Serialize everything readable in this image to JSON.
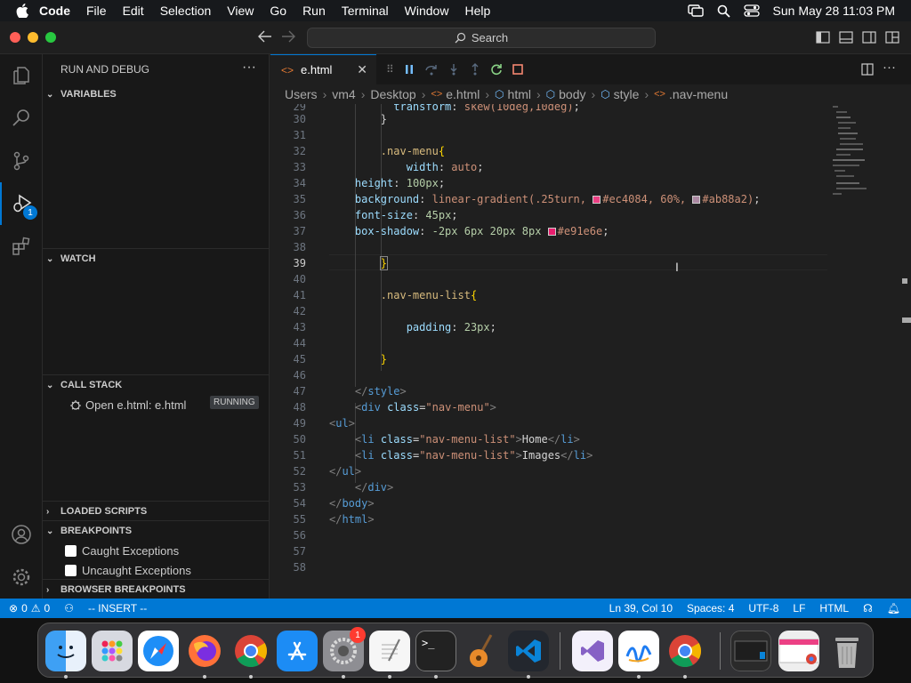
{
  "menubar": {
    "app": "Code",
    "items": [
      "File",
      "Edit",
      "Selection",
      "View",
      "Go",
      "Run",
      "Terminal",
      "Window",
      "Help"
    ],
    "clock": "Sun May 28  11:03 PM"
  },
  "titlebar": {
    "command_center": "Search"
  },
  "activity": {
    "debug_badge": "1"
  },
  "sidebar": {
    "title": "RUN AND DEBUG",
    "variables": "VARIABLES",
    "watch": "WATCH",
    "call_stack": "CALL STACK",
    "call_stack_item": "Open e.html: e.html",
    "call_stack_status": "RUNNING",
    "loaded_scripts": "LOADED SCRIPTS",
    "breakpoints": "BREAKPOINTS",
    "caught": "Caught Exceptions",
    "uncaught": "Uncaught Exceptions",
    "browser_breakpoints": "BROWSER BREAKPOINTS"
  },
  "editor": {
    "tab": "e.html",
    "breadcrumb": [
      "Users",
      "vm4",
      "Desktop",
      "e.html",
      "html",
      "body",
      "style",
      ".nav-menu"
    ],
    "line_numbers": [
      "29",
      "30",
      "31",
      "32",
      "33",
      "34",
      "35",
      "36",
      "37",
      "38",
      "39",
      "40",
      "41",
      "42",
      "43",
      "44",
      "45",
      "46",
      "47",
      "48",
      "49",
      "50",
      "51",
      "52",
      "53",
      "54",
      "55",
      "56",
      "57",
      "58"
    ],
    "current_line": "39",
    "colors": {
      "swatch1": "#ec4084",
      "swatch2": "#ab88a2",
      "swatch3": "#e91e6e"
    }
  },
  "status": {
    "errors": "0",
    "warnings": "0",
    "mode": "-- INSERT --",
    "position": "Ln 39, Col 10",
    "spaces": "Spaces: 4",
    "encoding": "UTF-8",
    "eol": "LF",
    "language": "HTML"
  },
  "dock": {
    "apps": [
      "finder",
      "launchpad",
      "safari",
      "firefox",
      "chrome",
      "app-store",
      "system-settings",
      "textedit",
      "terminal",
      "garageband",
      "vscode",
      "visual-studio",
      "freeform",
      "chrome-2"
    ],
    "settings_badge": "1"
  }
}
